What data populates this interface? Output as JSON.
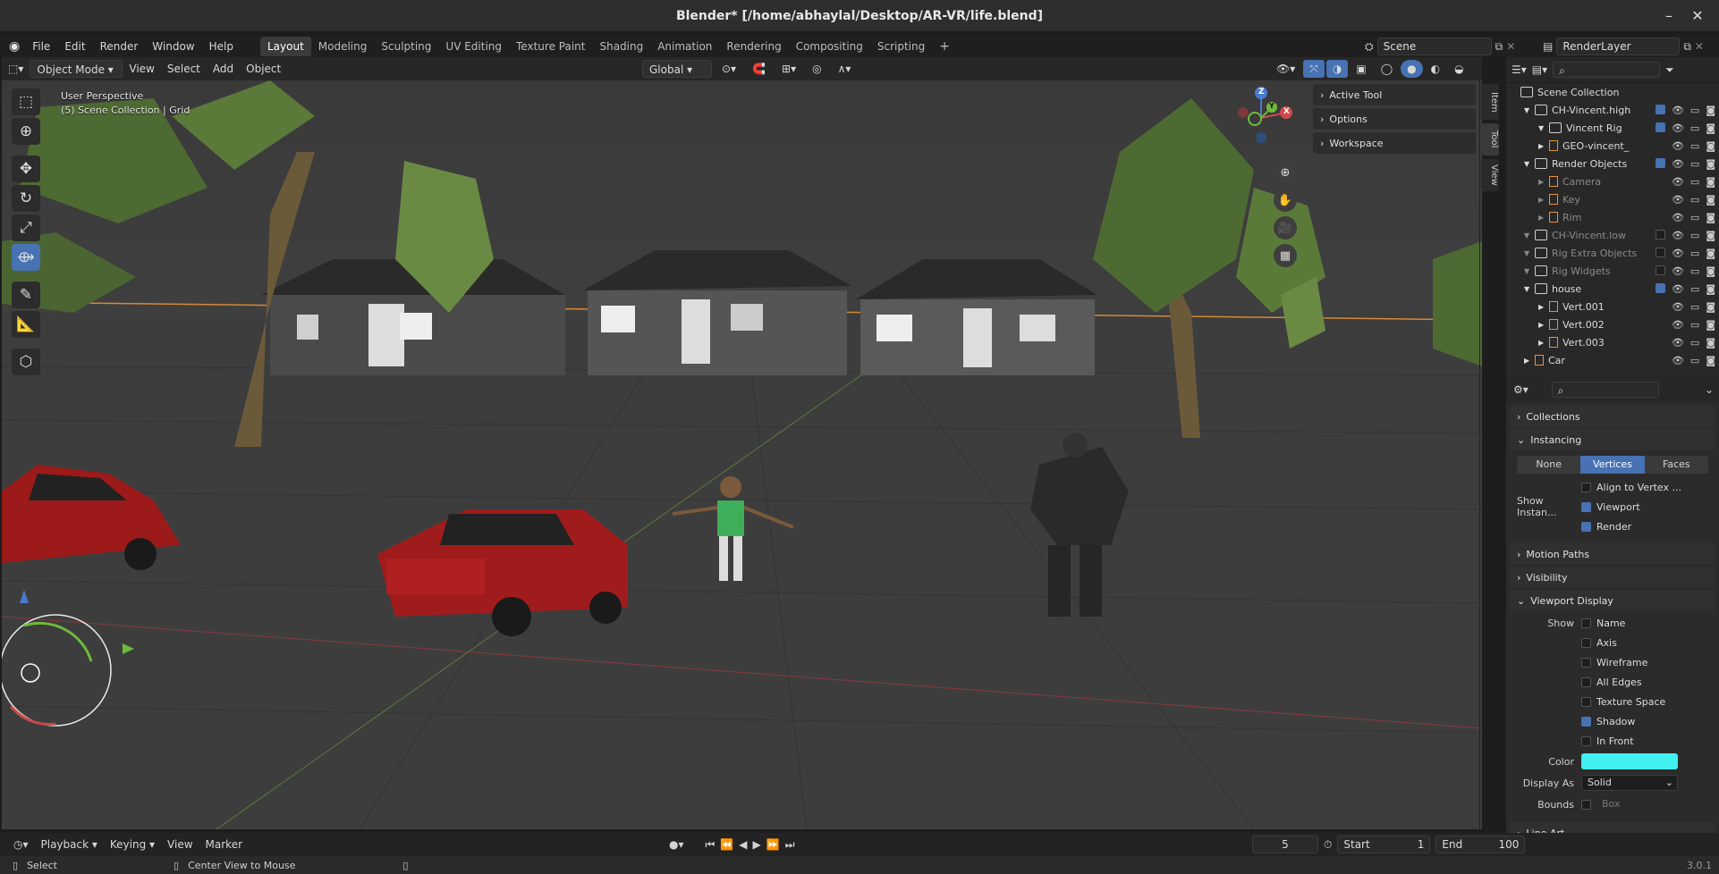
{
  "window": {
    "title": "Blender* [/home/abhaylal/Desktop/AR-VR/life.blend]"
  },
  "menu": [
    "File",
    "Edit",
    "Render",
    "Window",
    "Help"
  ],
  "workspaces": [
    "Layout",
    "Modeling",
    "Sculpting",
    "UV Editing",
    "Texture Paint",
    "Shading",
    "Animation",
    "Rendering",
    "Compositing",
    "Scripting"
  ],
  "active_workspace": "Layout",
  "scene": {
    "scene_name": "Scene",
    "view_layer": "RenderLayer"
  },
  "viewport_header": {
    "mode": "Object Mode",
    "items": [
      "View",
      "Select",
      "Add",
      "Object"
    ],
    "orientation": "Global"
  },
  "viewport": {
    "perspective": "User Perspective",
    "collection_info": "(5) Scene Collection | Grid"
  },
  "npanel": {
    "sections": [
      "Active Tool",
      "Options",
      "Workspace"
    ],
    "tabs": [
      "Item",
      "Tool",
      "View"
    ]
  },
  "gizmo": {
    "x": "X",
    "y": "Y",
    "z": "Z"
  },
  "outliner": {
    "rows": [
      {
        "label": "Scene Collection",
        "level": 0,
        "icon": "collection",
        "color": "#cfcfcf",
        "dim": false,
        "check": null
      },
      {
        "label": "CH-Vincent.high",
        "level": 1,
        "icon": "collection",
        "color": "#cfcfcf",
        "dim": false,
        "check": true
      },
      {
        "label": "Vincent Rig",
        "level": 2,
        "icon": "collection",
        "color": "#cfcfcf",
        "dim": false,
        "check": true
      },
      {
        "label": "GEO-vincent_",
        "level": 2,
        "icon": "object",
        "color": "#e8923c",
        "dim": false,
        "check": null
      },
      {
        "label": "Render Objects",
        "level": 1,
        "icon": "collection",
        "color": "#cfcfcf",
        "dim": false,
        "check": true
      },
      {
        "label": "Camera",
        "level": 2,
        "icon": "object",
        "color": "#e8923c",
        "dim": true,
        "check": null
      },
      {
        "label": "Key",
        "level": 2,
        "icon": "object",
        "color": "#e8923c",
        "dim": true,
        "check": null
      },
      {
        "label": "Rim",
        "level": 2,
        "icon": "object",
        "color": "#e8923c",
        "dim": true,
        "check": null
      },
      {
        "label": "CH-Vincent.low",
        "level": 1,
        "icon": "collection",
        "color": "#cfcfcf",
        "dim": true,
        "check": false
      },
      {
        "label": "Rig Extra Objects",
        "level": 1,
        "icon": "collection",
        "color": "#cfcfcf",
        "dim": true,
        "check": false
      },
      {
        "label": "Rig Widgets",
        "level": 1,
        "icon": "collection",
        "color": "#cfcfcf",
        "dim": true,
        "check": false
      },
      {
        "label": "house",
        "level": 1,
        "icon": "collection",
        "color": "#cfcfcf",
        "dim": false,
        "check": true
      },
      {
        "label": "Vert.001",
        "level": 2,
        "icon": "object",
        "color": "#e8923c",
        "dim": false,
        "check": null
      },
      {
        "label": "Vert.002",
        "level": 2,
        "icon": "object",
        "color": "#e8923c",
        "dim": false,
        "check": null
      },
      {
        "label": "Vert.003",
        "level": 2,
        "icon": "object",
        "color": "#e8923c",
        "dim": false,
        "check": null
      },
      {
        "label": "Car",
        "level": 1,
        "icon": "object",
        "color": "#e8923c",
        "dim": false,
        "check": null
      }
    ]
  },
  "properties": {
    "collections": "Collections",
    "instancing": "Instancing",
    "instancing_options": [
      "None",
      "Vertices",
      "Faces"
    ],
    "instancing_active": "Vertices",
    "align_to_vertex": "Align to Vertex ...",
    "show_instancer_label": "Show Instan...",
    "viewport": "Viewport",
    "render": "Render",
    "motion_paths": "Motion Paths",
    "visibility": "Visibility",
    "viewport_display": "Viewport Display",
    "show_label": "Show",
    "show_items": [
      {
        "label": "Name",
        "checked": false
      },
      {
        "label": "Axis",
        "checked": false
      },
      {
        "label": "Wireframe",
        "checked": false
      },
      {
        "label": "All Edges",
        "checked": false
      },
      {
        "label": "Texture Space",
        "checked": false
      },
      {
        "label": "Shadow",
        "checked": true
      },
      {
        "label": "In Front",
        "checked": false
      }
    ],
    "color_label": "Color",
    "color_value": "#41f0f0",
    "display_as_label": "Display As",
    "display_as": "Solid",
    "bounds_label": "Bounds",
    "bounds_value": "Box",
    "line_art": "Line Art"
  },
  "timeline": {
    "items": [
      "Playback",
      "Keying",
      "View",
      "Marker"
    ],
    "current_frame": "5",
    "start_label": "Start",
    "start": "1",
    "end_label": "End",
    "end": "100"
  },
  "statusbar": {
    "select": "Select",
    "center_view": "Center View to Mouse",
    "version": "3.0.1"
  },
  "colors": {
    "accent": "#4772b3",
    "header": "#2e2e2e",
    "panel": "#2b2b2b"
  }
}
